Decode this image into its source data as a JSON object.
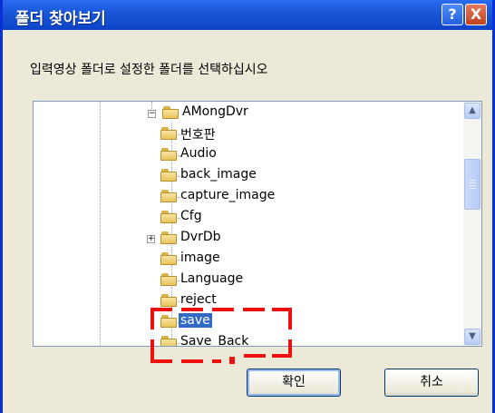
{
  "window": {
    "title": "폴더 찾아보기"
  },
  "titlebar": {
    "help_label": "?",
    "close_label": "X"
  },
  "instruction": "입력영상 폴더로 설정한 폴더를 선택하십시오",
  "tree": {
    "nodes": [
      {
        "label": "AMongDvr",
        "expander": "−"
      },
      {
        "label": "번호판"
      },
      {
        "label": "Audio"
      },
      {
        "label": "back_image"
      },
      {
        "label": "capture_image"
      },
      {
        "label": "Cfg"
      },
      {
        "label": "DvrDb",
        "expander": "+"
      },
      {
        "label": "image"
      },
      {
        "label": "Language"
      },
      {
        "label": "reject"
      },
      {
        "label": "save",
        "selected": true
      },
      {
        "label": "Save_Back"
      }
    ]
  },
  "buttons": {
    "ok": "확인",
    "cancel": "취소"
  },
  "icons": {
    "folder": "folder-icon",
    "scroll_up": "scroll-up-arrow-icon",
    "scroll_down": "scroll-down-arrow-icon"
  },
  "colors": {
    "selection": "#316ac5",
    "title_bar": "#0b44c8",
    "annotation": "#ee0f0f"
  }
}
